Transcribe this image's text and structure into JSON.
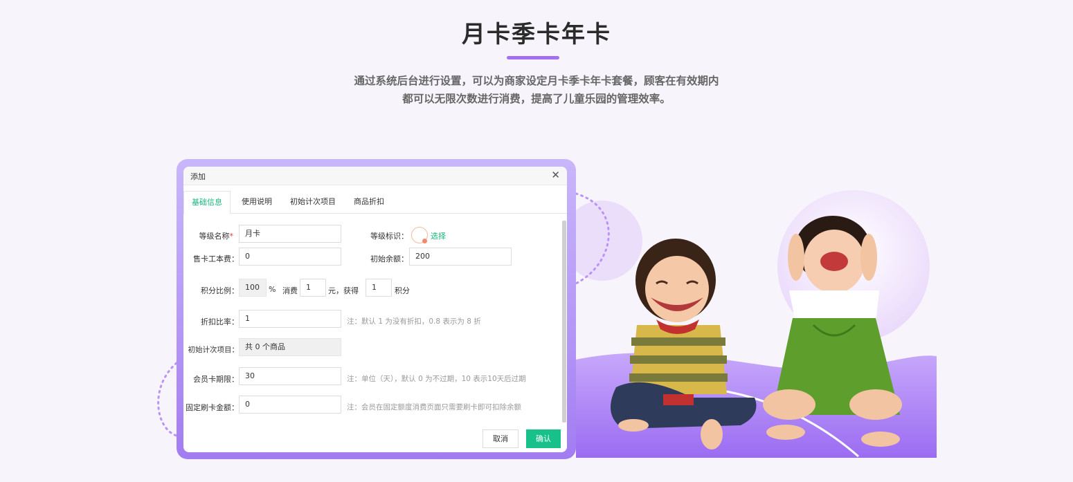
{
  "header": {
    "title": "月卡季卡年卡",
    "desc_line1": "通过系统后台进行设置，可以为商家设定月卡季卡年卡套餐，顾客在有效期内",
    "desc_line2": "都可以无限次数进行消费，提高了儿童乐园的管理效率。",
    "accent_color": "#a470f0"
  },
  "dialog": {
    "title": "添加",
    "close_icon": "close-icon",
    "tabs": [
      {
        "label": "基础信息",
        "active": true
      },
      {
        "label": "使用说明",
        "active": false
      },
      {
        "label": "初始计次项目",
        "active": false
      },
      {
        "label": "商品折扣",
        "active": false
      }
    ],
    "fields": {
      "level_name": {
        "label": "等级名称",
        "required_mark": "*",
        "value": "月卡"
      },
      "level_mark": {
        "label": "等级标识：",
        "link": "选择"
      },
      "card_fee": {
        "label": "售卡工本费：",
        "value": "0"
      },
      "initial_balance": {
        "label": "初始余额：",
        "value": "200"
      },
      "points": {
        "label": "积分比例：",
        "ratio_value": "100",
        "percent": "%",
        "consume_text": "消费",
        "consume_value": "1",
        "yuan_get_text": "元，获得",
        "points_value": "1",
        "points_unit": "积分"
      },
      "discount": {
        "label": "折扣比率：",
        "value": "1",
        "note": "注：默认 1 为没有折扣，0.8 表示为 8 折"
      },
      "initial_items": {
        "label": "初始计次项目：",
        "value": "共 0 个商品"
      },
      "validity": {
        "label": "会员卡期限：",
        "value": "30",
        "note": "注：单位（天），默认 0 为不过期，10 表示10天后过期"
      },
      "fixed_amount": {
        "label": "固定刷卡金额：",
        "value": "0",
        "note": "注：会员在固定额度消费页面只需要刷卡即可扣除余额"
      }
    },
    "buttons": {
      "cancel": "取消",
      "confirm": "确认"
    },
    "confirm_color": "#18c08a",
    "active_tab_color": "#16b87b"
  }
}
